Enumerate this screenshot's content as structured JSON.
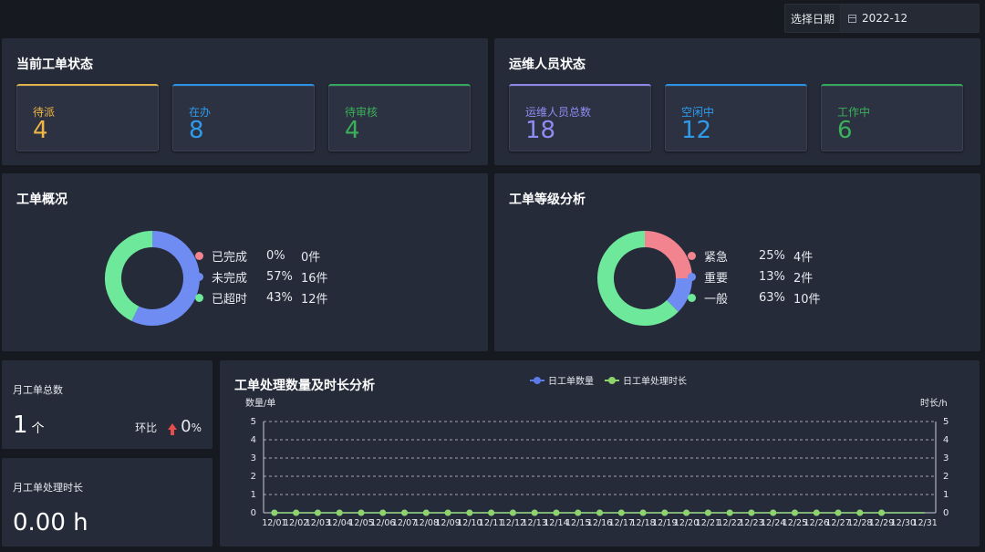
{
  "date_picker": {
    "label": "选择日期",
    "value": "2022-12"
  },
  "work_order_status": {
    "title": "当前工单状态",
    "cards": [
      {
        "label": "待派",
        "value": "4",
        "color": "#f0b643",
        "border": "#e0b34a"
      },
      {
        "label": "在办",
        "value": "8",
        "color": "#2f9bea",
        "border": "#2a92e0"
      },
      {
        "label": "待审核",
        "value": "4",
        "color": "#3bb05a",
        "border": "#36a85a"
      }
    ]
  },
  "staff_status": {
    "title": "运维人员状态",
    "cards": [
      {
        "label": "运维人员总数",
        "value": "18",
        "color": "#8f8cf2",
        "border": "#8e88e8"
      },
      {
        "label": "空闲中",
        "value": "12",
        "color": "#2f9bea",
        "border": "#2a92e0"
      },
      {
        "label": "工作中",
        "value": "6",
        "color": "#3bb05a",
        "border": "#36a85a"
      }
    ]
  },
  "overview": {
    "title": "工单概况",
    "items": [
      {
        "name": "已完成",
        "pct": "0%",
        "count": "0件",
        "color": "#f2848f",
        "value": 0
      },
      {
        "name": "未完成",
        "pct": "57%",
        "count": "16件",
        "color": "#6e8cf2",
        "value": 16
      },
      {
        "name": "已超时",
        "pct": "43%",
        "count": "12件",
        "color": "#6ee89a",
        "value": 12
      }
    ]
  },
  "level": {
    "title": "工单等级分析",
    "items": [
      {
        "name": "紧急",
        "pct": "25%",
        "count": "4件",
        "color": "#f2848f",
        "value": 4
      },
      {
        "name": "重要",
        "pct": "13%",
        "count": "2件",
        "color": "#6e8cf2",
        "value": 2
      },
      {
        "name": "一般",
        "pct": "63%",
        "count": "10件",
        "color": "#6ee89a",
        "value": 10
      }
    ]
  },
  "monthly_total": {
    "title": "月工单总数",
    "value": "1",
    "unit": "个",
    "ratio_label": "环比",
    "ratio_value": "0",
    "ratio_unit": "%"
  },
  "monthly_duration": {
    "title": "月工单处理时长",
    "value": "0.00 h"
  },
  "chart_data": {
    "type": "line",
    "title": "工单处理数量及时长分析",
    "ylabel_left": "数量/单",
    "ylabel_right": "时长/h",
    "ylim": [
      0,
      5
    ],
    "yticks": [
      "0",
      "1",
      "2",
      "3",
      "4",
      "5"
    ],
    "categories": [
      "12/01",
      "12/02",
      "12/03",
      "12/04",
      "12/05",
      "12/06",
      "12/07",
      "12/08",
      "12/09",
      "12/10",
      "12/11",
      "12/12",
      "12/13",
      "12/14",
      "12/15",
      "12/16",
      "12/17",
      "12/18",
      "12/19",
      "12/20",
      "12/21",
      "12/22",
      "12/23",
      "12/24",
      "12/25",
      "12/26",
      "12/27",
      "12/28",
      "12/29",
      "12/30",
      "12/31"
    ],
    "series": [
      {
        "name": "日工单数量",
        "color": "#5b7be8",
        "values": [
          0,
          0,
          0,
          0,
          0,
          0,
          0,
          0,
          0,
          0,
          0,
          0,
          0,
          0,
          0,
          0,
          0,
          0,
          0,
          0,
          0,
          0,
          0,
          0,
          0,
          0,
          0,
          0,
          0,
          0,
          0
        ]
      },
      {
        "name": "日工单处理时长",
        "color": "#8fd36b",
        "values": [
          0,
          0,
          0,
          0,
          0,
          0,
          0,
          0,
          0,
          0,
          0,
          0,
          0,
          0,
          0,
          0,
          0,
          0,
          0,
          0,
          0,
          0,
          0,
          0,
          0,
          0,
          0,
          0,
          0,
          0,
          0
        ]
      }
    ],
    "grid": true,
    "legend": "top-center"
  }
}
